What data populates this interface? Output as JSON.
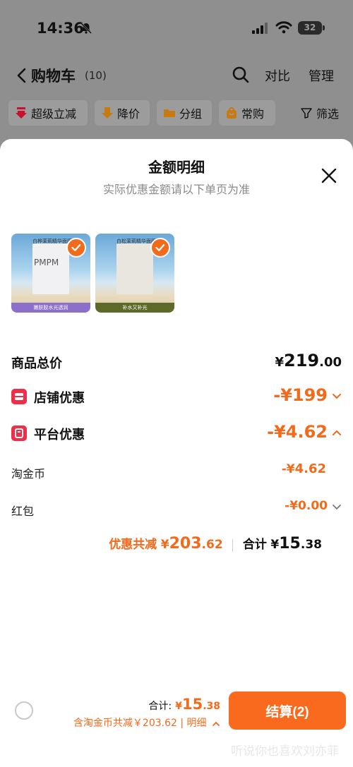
{
  "status_bar": {
    "time": "14:36",
    "battery": "32"
  },
  "nav": {
    "title": "购物车",
    "count": "(10)",
    "compare": "对比",
    "manage": "管理"
  },
  "filters": {
    "chips": [
      "超级立减",
      "降价",
      "分组",
      "常购"
    ],
    "filter_label": "筛选"
  },
  "sheet": {
    "title": "金额明细",
    "subtitle": "实际优惠金额请以下单页为准",
    "products": [
      {
        "pack_top": "白桦茉莉精华面膜1片",
        "brand": "PMPM",
        "strip": "嫩肤胶水光透润"
      },
      {
        "pack_top": "白松茉莉精华面膜1片",
        "brand": "",
        "strip": "补水又补光"
      }
    ],
    "rows": {
      "subtotal": {
        "label": "商品总价",
        "currency": "¥",
        "int": "219",
        "frac": ".00"
      },
      "shop_discount": {
        "label": "店铺优惠",
        "value": "-¥199"
      },
      "platform_discount": {
        "label": "平台优惠",
        "value": "-¥4.62"
      },
      "coins": {
        "label": "淘金币",
        "prefix": "-¥",
        "value": "4.62"
      },
      "red_packet": {
        "label": "红包",
        "prefix": "-¥",
        "value": "0.00"
      }
    },
    "summary": {
      "discount_label": "优惠共减",
      "discount_currency": "¥",
      "discount_int": "203",
      "discount_frac": ".62",
      "total_label": "合计",
      "total_currency": "¥",
      "total_int": "15",
      "total_frac": ".38"
    }
  },
  "bottom_bar": {
    "total_label": "合计:",
    "total_currency": "¥",
    "total_int": "15",
    "total_frac": ".38",
    "discount_text": "含淘金币共减￥203.62 | 明细",
    "checkout_label": "结算(2)",
    "watermark": "听说你也喜欢刘亦菲"
  },
  "colors": {
    "accent": "#f26a1b",
    "checkout": "#fa6a1e",
    "badge": "#ef2e4a"
  }
}
